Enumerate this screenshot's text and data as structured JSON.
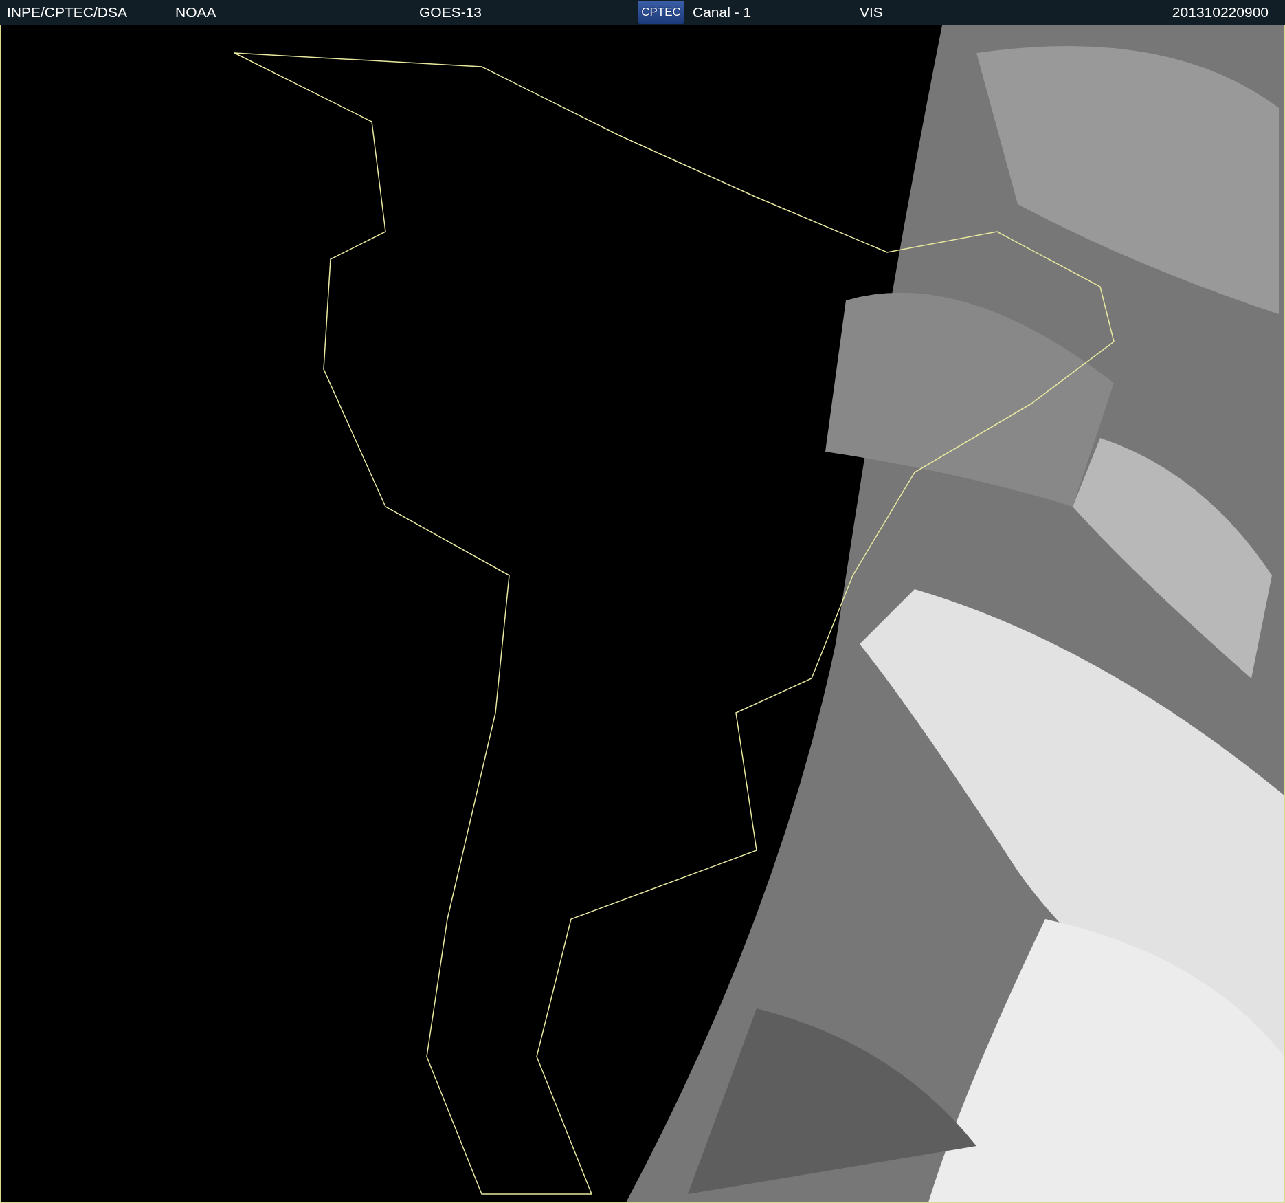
{
  "header": {
    "institution": "INPE/CPTEC/DSA",
    "agency": "NOAA",
    "satellite": "GOES-13",
    "logo": "CPTEC",
    "channel": "Canal - 1",
    "band": "VIS",
    "timestamp": "201310220900"
  }
}
